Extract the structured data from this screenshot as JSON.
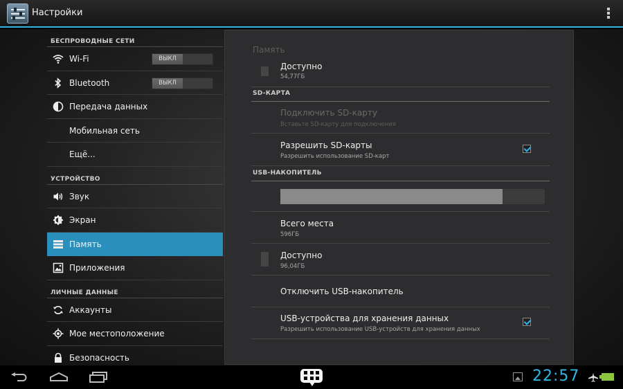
{
  "app": {
    "title": "Настройки"
  },
  "sidebar": {
    "sections": [
      {
        "label": "БЕСПРОВОДНЫЕ СЕТИ"
      },
      {
        "label": "УСТРОЙСТВО"
      },
      {
        "label": "ЛИЧНЫЕ ДАННЫЕ"
      }
    ],
    "items": [
      {
        "label": "Wi-Fi",
        "icon": "wifi-icon",
        "toggle": "ВЫКЛ"
      },
      {
        "label": "Bluetooth",
        "icon": "bluetooth-icon",
        "toggle": "ВЫКЛ"
      },
      {
        "label": "Передача данных",
        "icon": "data-usage-icon"
      },
      {
        "label": "Мобильная сеть"
      },
      {
        "label": "Ещё..."
      },
      {
        "label": "Звук",
        "icon": "speaker-icon"
      },
      {
        "label": "Экран",
        "icon": "brightness-icon"
      },
      {
        "label": "Память",
        "icon": "storage-icon",
        "active": true
      },
      {
        "label": "Приложения",
        "icon": "apps-icon"
      },
      {
        "label": "Аккаунты",
        "icon": "sync-icon"
      },
      {
        "label": "Мое местоположение",
        "icon": "location-icon"
      },
      {
        "label": "Безопасность",
        "icon": "lock-icon"
      }
    ]
  },
  "panel": {
    "title": "Память",
    "top_row": {
      "title": "Доступно",
      "subtitle": "54,77ГБ"
    },
    "sd_section": "SD-КАРТА",
    "mount_sd": {
      "title": "Подключить SD-карту",
      "subtitle": "Вставьте SD-карту для подключения"
    },
    "allow_sd": {
      "title": "Разрешить SD-карты",
      "subtitle": "Разрешить использование SD-карт",
      "checked": true
    },
    "usb_section": "USB-НАКОПИТЕЛЬ",
    "usb_usage_fraction": 0.84,
    "total": {
      "title": "Всего места",
      "subtitle": "596ГБ"
    },
    "available": {
      "title": "Доступно",
      "subtitle": "96,04ГБ"
    },
    "unmount_usb": {
      "title": "Отключить USB-накопитель"
    },
    "usb_storage": {
      "title": "USB-устройства для хранения данных",
      "subtitle": "Разрешить использование USB-устройств для хранения данных",
      "checked": true
    }
  },
  "statusbar": {
    "time": "22:57"
  },
  "colors": {
    "accent": "#33b5e5",
    "selected": "#2a8fbd",
    "battery": "#8cc63f"
  }
}
